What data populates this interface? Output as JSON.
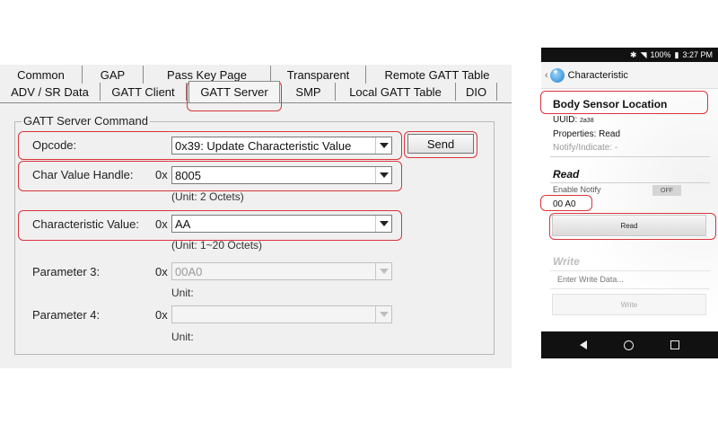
{
  "tabs_row1": [
    "Common",
    "GAP",
    "Pass Key Page",
    "Transparent",
    "Remote GATT Table"
  ],
  "tabs_row2": [
    "ADV / SR Data",
    "GATT Client",
    "GATT Server",
    "SMP",
    "Local GATT Table",
    "DIO"
  ],
  "group_title": "GATT Server Command",
  "opcode": {
    "label": "Opcode:",
    "value": "0x39: Update Characteristic Value"
  },
  "send_label": "Send",
  "handle": {
    "label": "Char Value Handle:",
    "prefix": "0x",
    "value": "8005",
    "unit": "(Unit: 2 Octets)"
  },
  "char_value": {
    "label": "Characteristic Value:",
    "prefix": "0x",
    "value": "AA",
    "unit": "(Unit: 1~20 Octets)"
  },
  "param3": {
    "label": "Parameter 3:",
    "prefix": "0x",
    "value": "00A0",
    "unit": "Unit:"
  },
  "param4": {
    "label": "Parameter 4:",
    "prefix": "0x",
    "value": "",
    "unit": "Unit:"
  },
  "phone": {
    "status_battery": "100%",
    "status_time": "3:27 PM",
    "appbar_title": "Characteristic",
    "char_name": "Body Sensor Location",
    "uuid_label": "UUID:",
    "uuid_value": "2a38",
    "properties": "Properties: Read",
    "notify": "Notify/Indicate: -",
    "read_section": "Read",
    "enable_notify": "Enable Notify",
    "toggle_state": "OFF",
    "read_value": "00 A0",
    "read_button": "Read",
    "write_section": "Write",
    "write_placeholder": "Enter Write Data...",
    "write_button": "Write"
  },
  "colors": {
    "highlight": "#d8353d",
    "dialog_bg": "#f0f0f0"
  }
}
